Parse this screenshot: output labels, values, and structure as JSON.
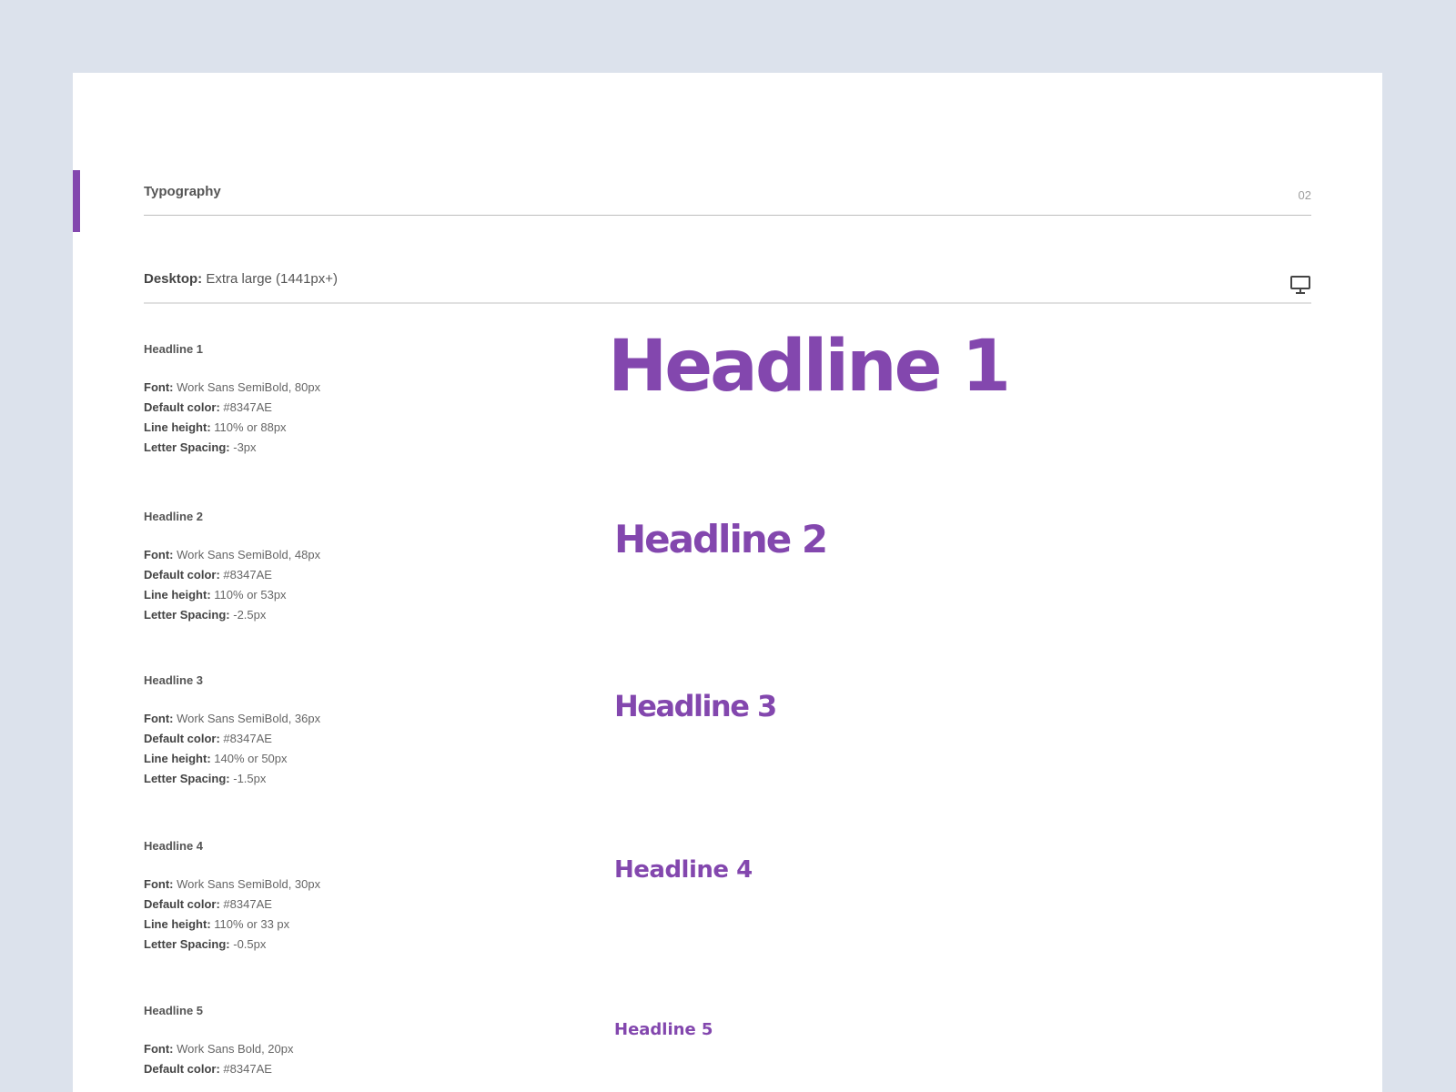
{
  "header": {
    "title": "Typography",
    "number": "02"
  },
  "breakpoint": {
    "label": "Desktop:",
    "value": "Extra large (1441px+)",
    "icon": "monitor-icon"
  },
  "colors": {
    "accent": "#8347AE",
    "background": "#DCE2EC"
  },
  "styles": [
    {
      "name": "Headline 1",
      "sample": "Headline 1",
      "font_label": "Font:",
      "font": "Work Sans SemiBold, 80px",
      "color_label": "Default color:",
      "color": "#8347AE",
      "line_height_label": "Line height:",
      "line_height": "110% or 88px",
      "letter_spacing_label": "Letter Spacing:",
      "letter_spacing": "-3px"
    },
    {
      "name": "Headline 2",
      "sample": "Headline 2",
      "font_label": "Font:",
      "font": "Work Sans SemiBold, 48px",
      "color_label": "Default color:",
      "color": "#8347AE",
      "line_height_label": "Line height:",
      "line_height": "110% or 53px",
      "letter_spacing_label": "Letter Spacing:",
      "letter_spacing": "-2.5px"
    },
    {
      "name": "Headline 3",
      "sample": "Headline 3",
      "font_label": "Font:",
      "font": "Work Sans SemiBold, 36px",
      "color_label": "Default color:",
      "color": "#8347AE",
      "line_height_label": "Line height:",
      "line_height": "140% or 50px",
      "letter_spacing_label": "Letter Spacing:",
      "letter_spacing": "-1.5px"
    },
    {
      "name": "Headline 4",
      "sample": "Headline 4",
      "font_label": "Font:",
      "font": "Work Sans SemiBold, 30px",
      "color_label": "Default color:",
      "color": "#8347AE",
      "line_height_label": "Line height:",
      "line_height": "110% or 33 px",
      "letter_spacing_label": "Letter Spacing:",
      "letter_spacing": "-0.5px"
    },
    {
      "name": "Headline 5",
      "sample": "Headline 5",
      "font_label": "Font:",
      "font": "Work Sans Bold, 20px",
      "color_label": "Default color:",
      "color": "#8347AE"
    }
  ]
}
